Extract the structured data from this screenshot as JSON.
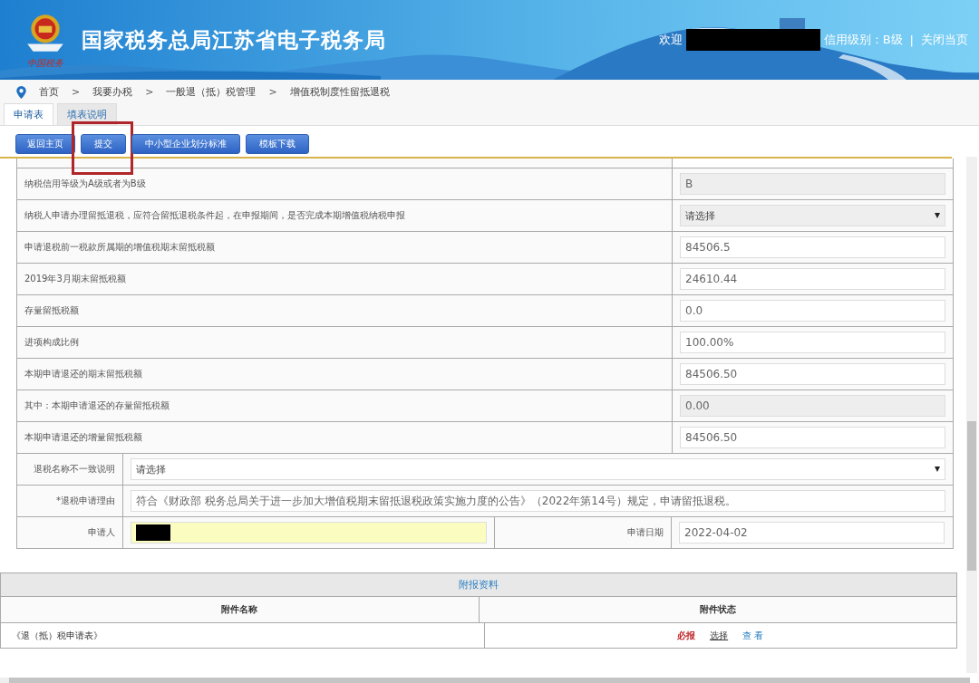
{
  "header": {
    "logo_caption": "中国税务",
    "title": "国家税务总局江苏省电子税务局",
    "welcome": "欢迎",
    "credit": "信用级别：B级",
    "separator": "|",
    "close": "关闭当页"
  },
  "breadcrumb": [
    {
      "kind": "link",
      "text": "首页"
    },
    {
      "kind": "separator",
      "text": ">"
    },
    {
      "kind": "link",
      "text": "我要办税"
    },
    {
      "kind": "separator",
      "text": ">"
    },
    {
      "kind": "link",
      "text": "一般退（抵）税管理"
    },
    {
      "kind": "separator",
      "text": ">"
    },
    {
      "kind": "link",
      "text": "增值税制度性留抵退税"
    }
  ],
  "tabs": [
    {
      "label": "申请表",
      "selected": true
    },
    {
      "label": "填表说明",
      "selected": false
    }
  ],
  "buttons": [
    {
      "label": "返回主页",
      "highlighted": false
    },
    {
      "label": "提交",
      "highlighted": true
    },
    {
      "label": "中小型企业划分标准",
      "highlighted": false
    },
    {
      "label": "模板下载",
      "highlighted": false
    }
  ],
  "rows": [
    {
      "label": "纳税信用等级为A级或者为B级",
      "value": "B",
      "kind": "readonly"
    },
    {
      "label": "纳税人申请办理留抵退税，应符合留抵退税条件起，在申报期间，是否完成本期增值税纳税申报",
      "value": "请选择",
      "kind": "select"
    },
    {
      "label": "申请退税前一税款所属期的增值税期末留抵税额",
      "value": "84506.5",
      "kind": "input"
    },
    {
      "label": "2019年3月期末留抵税额",
      "value": "24610.44",
      "kind": "input"
    },
    {
      "label": "存量留抵税额",
      "value": "0.0",
      "kind": "input"
    },
    {
      "label": "进项构成比例",
      "value": "100.00%",
      "kind": "input"
    },
    {
      "label": "本期申请退还的期末留抵税额",
      "value": "84506.50",
      "kind": "input"
    },
    {
      "label": "其中：本期申请退还的存量留抵税额",
      "value": "0.00",
      "kind": "readonly"
    },
    {
      "label": "本期申请退还的增量留抵税额",
      "value": "84506.50",
      "kind": "input"
    }
  ],
  "mismatch_note": {
    "label": "退税名称不一致说明",
    "value": "请选择"
  },
  "reason": {
    "label": "*退税申请理由",
    "value": "符合《财政部 税务总局关于进一步加大增值税期末留抵退税政策实施力度的公告》（2022年第14号）规定，申请留抵退税。"
  },
  "applicant": {
    "label": "申请人"
  },
  "apply_date": {
    "label": "申请日期",
    "value": "2022-04-02"
  },
  "attachments": {
    "title": "附报资料",
    "columns": [
      "附件名称",
      "附件状态"
    ],
    "rows": [
      {
        "name": "《退（抵）税申请表》",
        "required": "必报",
        "choose": "选择",
        "view": "查 看"
      }
    ]
  }
}
